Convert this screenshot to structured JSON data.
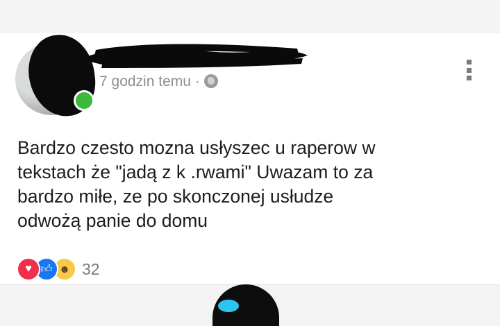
{
  "post": {
    "meta": {
      "time": "7 godzin temu",
      "separator": "·",
      "privacy_icon": "globe-icon"
    },
    "menu_icon": "more-vertical-icon",
    "text_lines": [
      "Bardzo czesto mozna usłyszec u raperow w",
      "tekstach że \"jadą z k .rwami\" Uwazam to za",
      "bardzo miłe, ze po skonczonej usłudze",
      "odwożą panie do domu"
    ],
    "reactions": {
      "icons": [
        "love-icon",
        "like-icon",
        "haha-icon"
      ],
      "count": "32"
    }
  },
  "colors": {
    "online": "#3cba3c",
    "love": "#f0304a",
    "like": "#1877f2",
    "haha": "#f7c94a",
    "meta_text": "#8e8e8e"
  }
}
